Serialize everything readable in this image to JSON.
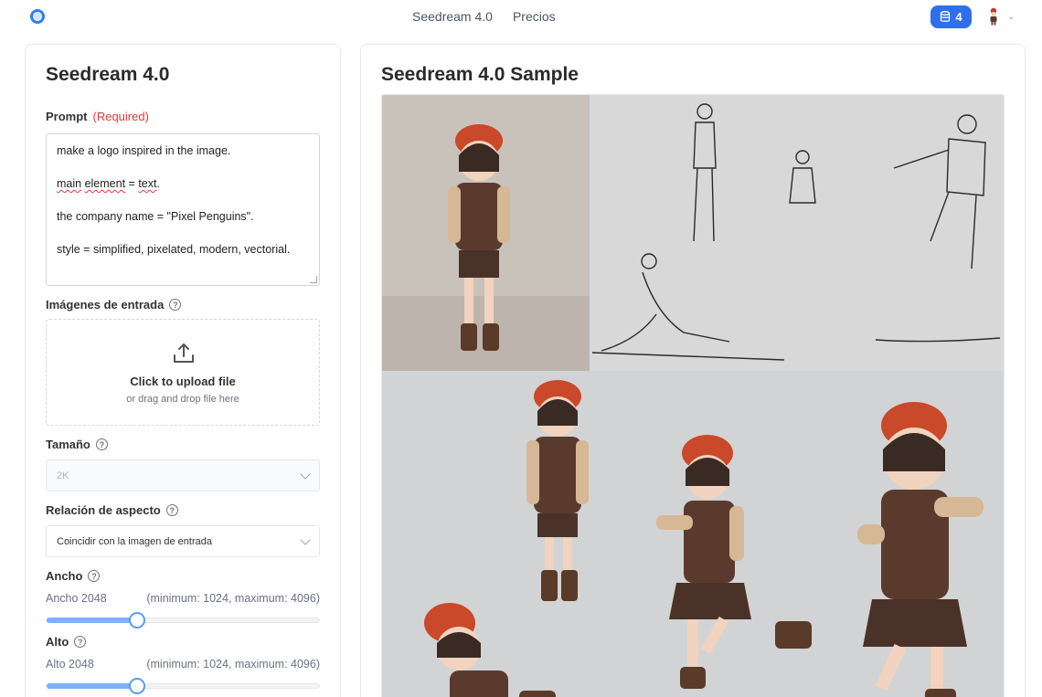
{
  "topbar": {
    "nav": [
      "Seedream 4.0",
      "Precios"
    ],
    "credits": "4"
  },
  "left": {
    "title": "Seedream 4.0",
    "prompt": {
      "label": "Prompt",
      "required": "(Required)",
      "lines": [
        "make a logo inspired in the image.",
        "main element = text.",
        "the company name = \"Pixel Penguins\".",
        "style = simplified, pixelated, modern, vectorial."
      ]
    },
    "images": {
      "label": "Imágenes de entrada",
      "upload_title": "Click to upload file",
      "upload_sub": "or drag and drop file here"
    },
    "size": {
      "label": "Tamaño",
      "value": "2K"
    },
    "aspect": {
      "label": "Relación de aspecto",
      "value": "Coincidir con la imagen de entrada"
    },
    "width": {
      "label": "Ancho",
      "value_text": "Ancho 2048",
      "range_text": "(minimum: 1024, maximum: 4096)",
      "value": 2048,
      "min": 1024,
      "max": 4096
    },
    "height": {
      "label": "Alto",
      "value_text": "Alto 2048",
      "range_text": "(minimum: 1024, maximum: 4096)",
      "value": 2048,
      "min": 1024,
      "max": 4096
    }
  },
  "right": {
    "title": "Seedream 4.0 Sample"
  },
  "colors": {
    "accent": "#2f6fed",
    "required": "#e53935",
    "slider_fill": "#7fb0f8"
  }
}
